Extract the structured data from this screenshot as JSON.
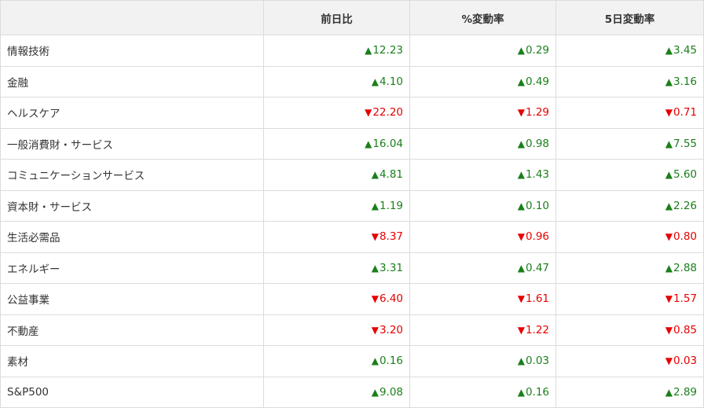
{
  "table": {
    "headers": [
      "",
      "前日比",
      "%変動率",
      "5日変動率"
    ],
    "rows": [
      {
        "name": "情報技術",
        "cells": [
          {
            "dir": "up",
            "value": "12.23"
          },
          {
            "dir": "up",
            "value": "0.29"
          },
          {
            "dir": "up",
            "value": "3.45"
          }
        ]
      },
      {
        "name": "金融",
        "cells": [
          {
            "dir": "up",
            "value": "4.10"
          },
          {
            "dir": "up",
            "value": "0.49"
          },
          {
            "dir": "up",
            "value": "3.16"
          }
        ]
      },
      {
        "name": "ヘルスケア",
        "cells": [
          {
            "dir": "down",
            "value": "22.20"
          },
          {
            "dir": "down",
            "value": "1.29"
          },
          {
            "dir": "down",
            "value": "0.71"
          }
        ]
      },
      {
        "name": "一般消費財・サービス",
        "cells": [
          {
            "dir": "up",
            "value": "16.04"
          },
          {
            "dir": "up",
            "value": "0.98"
          },
          {
            "dir": "up",
            "value": "7.55"
          }
        ]
      },
      {
        "name": "コミュニケーションサービス",
        "cells": [
          {
            "dir": "up",
            "value": "4.81"
          },
          {
            "dir": "up",
            "value": "1.43"
          },
          {
            "dir": "up",
            "value": "5.60"
          }
        ]
      },
      {
        "name": "資本財・サービス",
        "cells": [
          {
            "dir": "up",
            "value": "1.19"
          },
          {
            "dir": "up",
            "value": "0.10"
          },
          {
            "dir": "up",
            "value": "2.26"
          }
        ]
      },
      {
        "name": "生活必需品",
        "cells": [
          {
            "dir": "down",
            "value": "8.37"
          },
          {
            "dir": "down",
            "value": "0.96"
          },
          {
            "dir": "down",
            "value": "0.80"
          }
        ]
      },
      {
        "name": "エネルギー",
        "cells": [
          {
            "dir": "up",
            "value": "3.31"
          },
          {
            "dir": "up",
            "value": "0.47"
          },
          {
            "dir": "up",
            "value": "2.88"
          }
        ]
      },
      {
        "name": "公益事業",
        "cells": [
          {
            "dir": "down",
            "value": "6.40"
          },
          {
            "dir": "down",
            "value": "1.61"
          },
          {
            "dir": "down",
            "value": "1.57"
          }
        ]
      },
      {
        "name": "不動産",
        "cells": [
          {
            "dir": "down",
            "value": "3.20"
          },
          {
            "dir": "down",
            "value": "1.22"
          },
          {
            "dir": "down",
            "value": "0.85"
          }
        ]
      },
      {
        "name": "素材",
        "cells": [
          {
            "dir": "up",
            "value": "0.16"
          },
          {
            "dir": "up",
            "value": "0.03"
          },
          {
            "dir": "down",
            "value": "0.03"
          }
        ]
      },
      {
        "name": "S&P500",
        "cells": [
          {
            "dir": "up",
            "value": "9.08"
          },
          {
            "dir": "up",
            "value": "0.16"
          },
          {
            "dir": "up",
            "value": "2.89"
          }
        ]
      }
    ]
  },
  "symbols": {
    "up": "▲",
    "down": "▼"
  },
  "colors": {
    "up": "#1a7f1a",
    "down": "#e60000",
    "header_bg": "#f2f2f2",
    "border": "#dcdcdc"
  }
}
